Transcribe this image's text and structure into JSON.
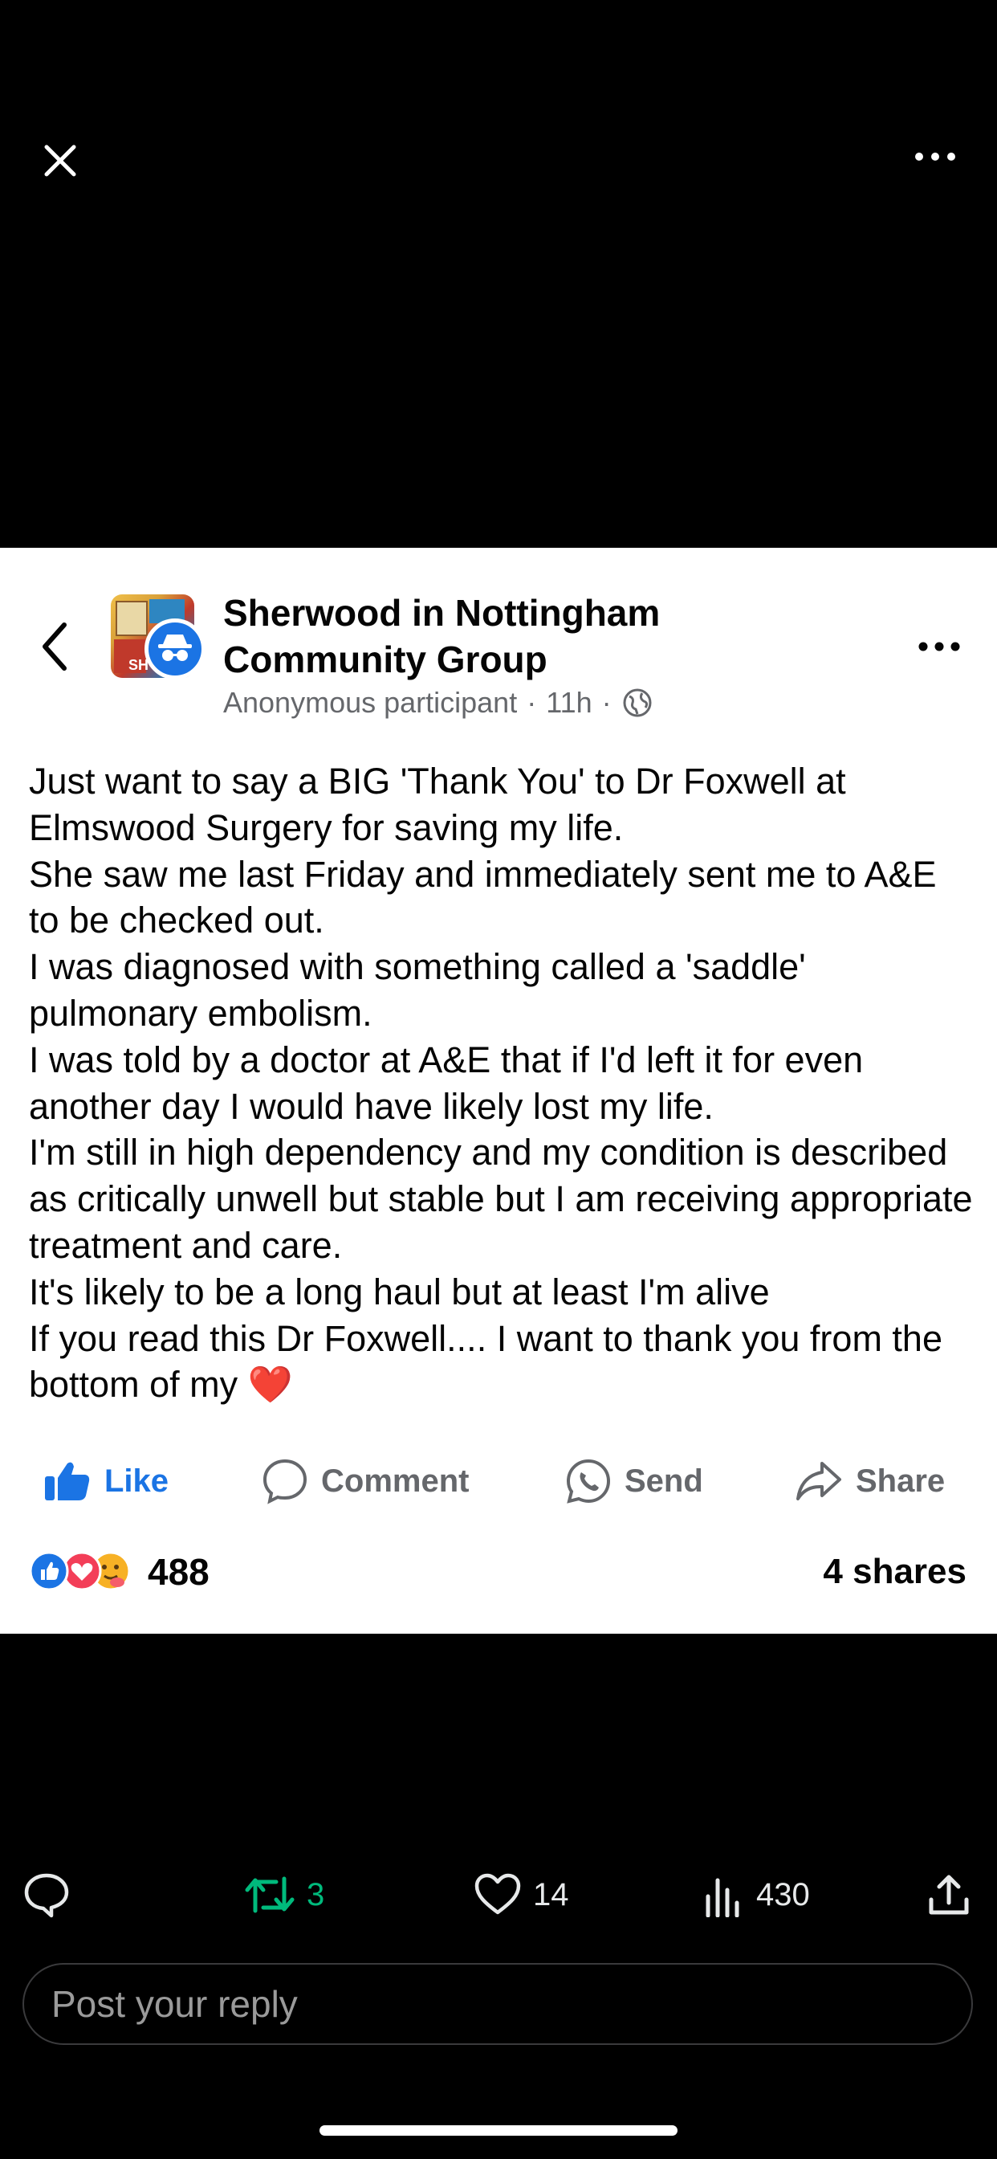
{
  "viewer": {
    "close_icon": "close-icon",
    "more_icon": "more-horizontal-icon"
  },
  "post": {
    "group_name": "Sherwood in Nottingham Community Group",
    "author": "Anonymous participant",
    "separator": "·",
    "time": "11h",
    "privacy_icon": "globe-icon",
    "paragraphs": [
      "Just want to say a BIG 'Thank You' to Dr Foxwell at Elmswood Surgery for saving my life.",
      "She saw me last Friday and immediately sent me to A&E to be checked out.",
      "I was diagnosed with something called a 'saddle' pulmonary embolism.",
      "I was told by a doctor at A&E that if I'd left it for even another day I would have likely lost my life.",
      "I'm still in high dependency and my condition is described as critically unwell but stable but I am receiving appropriate treatment and care.",
      "It's likely to be a long haul but at least I'm alive",
      "If you read this Dr Foxwell.... I want to thank you from the bottom of my ❤️"
    ],
    "actions": {
      "like": "Like",
      "comment": "Comment",
      "send": "Send",
      "share": "Share"
    },
    "reactions_count": "488",
    "shares": "4 shares",
    "colors": {
      "accent": "#1b74e4",
      "muted": "#65676b"
    }
  },
  "tweet_bar": {
    "retweets": "3",
    "likes": "14",
    "views": "430",
    "retweet_color": "#00ba7c"
  },
  "reply": {
    "placeholder": "Post your reply"
  }
}
